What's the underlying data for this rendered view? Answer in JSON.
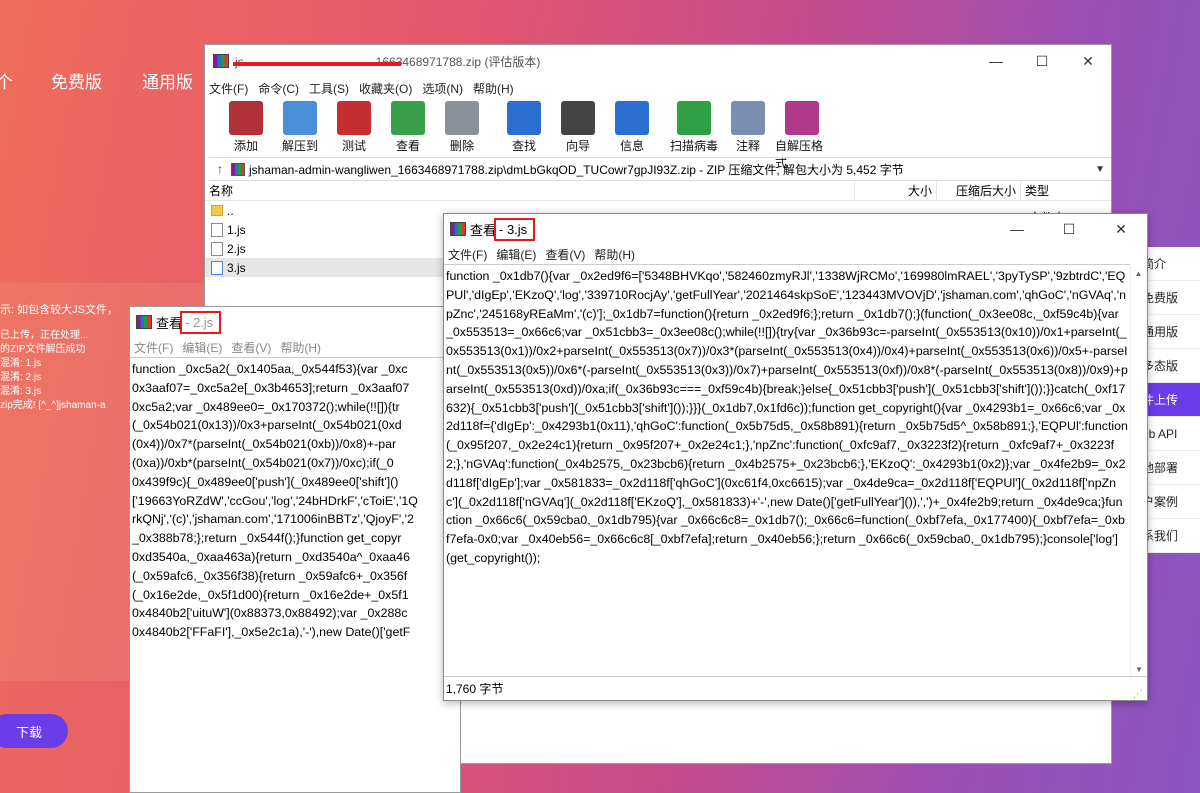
{
  "background": {
    "nav": [
      "个",
      "免费版",
      "通用版"
    ],
    "hint": "示: 如包含较大JS文件，",
    "log": [
      "已上传，正在处理...",
      "的ZIP文件解压成功",
      "混淆: 1.js",
      "混淆: 2.js",
      "混淆: 3.js",
      "zip完成! [^_^]jshaman-a"
    ],
    "download_label": "下载",
    "right_menu": [
      "简介",
      "免费版",
      "通用版",
      "多态版",
      "件上传",
      "eb API",
      "地部署",
      "户案例",
      "系我们"
    ],
    "right_menu_active_index": 4
  },
  "rar": {
    "title_prefix": "js",
    "title_suffix": "1663468971788.zip (评估版本)",
    "window_controls": [
      "—",
      "☐",
      "✕"
    ],
    "menu": [
      "文件(F)",
      "命令(C)",
      "工具(S)",
      "收藏夹(O)",
      "选项(N)",
      "帮助(H)"
    ],
    "toolbar": [
      {
        "label": "添加",
        "icon": "add-archive-icon",
        "color": "#b0303a"
      },
      {
        "label": "解压到",
        "icon": "extract-folder-icon",
        "color": "#4a90d9"
      },
      {
        "label": "测试",
        "icon": "test-clipboard-icon",
        "color": "#c43030"
      },
      {
        "label": "查看",
        "icon": "view-book-icon",
        "color": "#3aa04a"
      },
      {
        "label": "删除",
        "icon": "delete-trash-icon",
        "color": "#8a8f99"
      },
      {
        "label": "查找",
        "icon": "find-magnifier-icon",
        "color": "#2a6fd0"
      },
      {
        "label": "向导",
        "icon": "wizard-wand-icon",
        "color": "#444"
      },
      {
        "label": "信息",
        "icon": "info-icon",
        "color": "#2a6fd0"
      },
      {
        "label": "扫描病毒",
        "icon": "virus-scan-icon",
        "color": "#2ea043"
      },
      {
        "label": "注释",
        "icon": "comment-icon",
        "color": "#7a8fb0"
      },
      {
        "label": "自解压格式",
        "icon": "sfx-archive-icon",
        "color": "#b03a8a"
      }
    ],
    "path": "jshaman-admin-wangliwen_1663468971788.zip\\dmLbGkqOD_TUCowr7gpJI93Z.zip - ZIP 压缩文件, 解包大小为 5,452 字节",
    "columns": {
      "name": "名称",
      "size": "大小",
      "csize": "压缩后大小",
      "type": "类型"
    },
    "type_partial": "文件夹",
    "files": [
      "..",
      "1.js",
      "2.js",
      "3.js"
    ]
  },
  "viewer2": {
    "title": "查看",
    "file": " - 2.js",
    "menu": [
      "文件(F)",
      "编辑(E)",
      "查看(V)",
      "帮助(H)"
    ],
    "lines": [
      "function _0xc5a2(_0x1405aa,_0x544f53){var _0xc",
      "0x3aaf07=_0xc5a2e[_0x3b4653];return _0x3aaf07",
      "0xc5a2;var _0x489ee0=_0x170372();while(!![]){tr",
      "(_0x54b021(0x13))/0x3+parseInt(_0x54b021(0xd",
      "(0x4))/0x7*(parseInt(_0x54b021(0xb))/0x8)+-par",
      "(0xa))/0xb*(parseInt(_0x54b021(0x7))/0xc);if(_0",
      "0x439f9c){_0x489ee0['push'](_0x489ee0['shift']()",
      "['19663YoRZdW','ccGou','log','24bHDrkF','cToiE','1Q",
      "rkQNj','(c)','jshaman.com','171006inBBTz','QjoyF','2",
      "_0x388b78;};return _0x544f();}function get_copyr",
      "0xd3540a,_0xaa463a){return _0xd3540a^_0xaa46",
      "(_0x59afc6,_0x356f38){return _0x59afc6+_0x356f",
      "(_0x16e2de,_0x5f1d00){return _0x16e2de+_0x5f1",
      "0x4840b2['uituW'](0x88373,0x88492);var _0x288c",
      "0x4840b2['FFaFI'],_0x5e2c1a),'-'),new Date()['getF"
    ]
  },
  "viewer3": {
    "title": "查看",
    "file": " - 3.js",
    "menu": [
      "文件(F)",
      "编辑(E)",
      "查看(V)",
      "帮助(H)"
    ],
    "code": "function _0x1db7(){var _0x2ed9f6=['5348BHVKqo','582460zmyRJl','1338WjRCMo','169980lmRAEL','3pyTySP','9zbtrdC','EQPUl','dIgEp','EKzoQ','log','339710RocjAy','getFullYear','2021464skpSoE','123443MVOVjD','jshaman.com','qhGoC','nGVAq','npZnc','245168yREaMm','(c)'];_0x1db7=function(){return _0x2ed9f6;};return _0x1db7();}(function(_0x3ee08c,_0xf59c4b){var _0x553513=_0x66c6;var _0x51cbb3=_0x3ee08c();while(!![]){try{var _0x36b93c=-parseInt(_0x553513(0x10))/0x1+parseInt(_0x553513(0x1))/0x2+parseInt(_0x553513(0x7))/0x3*(parseInt(_0x553513(0x4))/0x4)+parseInt(_0x553513(0x6))/0x5+-parseInt(_0x553513(0x5))/0x6*(-parseInt(_0x553513(0x3))/0x7)+parseInt(_0x553513(0xf))/0x8*(-parseInt(_0x553513(0x8))/0x9)+parseInt(_0x553513(0xd))/0xa;if(_0x36b93c===_0xf59c4b){break;}else{_0x51cbb3['push'](_0x51cbb3['shift']());}}catch(_0xf17632){_0x51cbb3['push'](_0x51cbb3['shift']());}}}(_0x1db7,0x1fd6c));function get_copyright(){var _0x4293b1=_0x66c6;var _0x2d118f={'dIgEp':_0x4293b1(0x11),'qhGoC':function(_0x5b75d5,_0x58b891){return _0x5b75d5^_0x58b891;},'EQPUl':function(_0x95f207,_0x2e24c1){return _0x95f207+_0x2e24c1;},'npZnc':function(_0xfc9af7,_0x3223f2){return _0xfc9af7+_0x3223f2;},'nGVAq':function(_0x4b2575,_0x23bcb6){return _0x4b2575+_0x23bcb6;},'EKzoQ':_0x4293b1(0x2)};var _0x4fe2b9=_0x2d118f['dIgEp'];var _0x581833=_0x2d118f['qhGoC'](0xc61f4,0xc6615);var _0x4de9ca=_0x2d118f['EQPUl'](_0x2d118f['npZnc'](_0x2d118f['nGVAq'](_0x2d118f['EKzoQ'],_0x581833)+'-',new Date()['getFullYear']()),',')+_0x4fe2b9;return _0x4de9ca;}function _0x66c6(_0x59cba0,_0x1db795){var _0x66c6c8=_0x1db7();_0x66c6=function(_0xbf7efa,_0x177400){_0xbf7efa=_0xbf7efa-0x0;var _0x40eb56=_0x66c6c8[_0xbf7efa];return _0x40eb56;};return _0x66c6(_0x59cba0,_0x1db795);}console['log'](get_copyright());",
    "status": "1,760 字节"
  }
}
